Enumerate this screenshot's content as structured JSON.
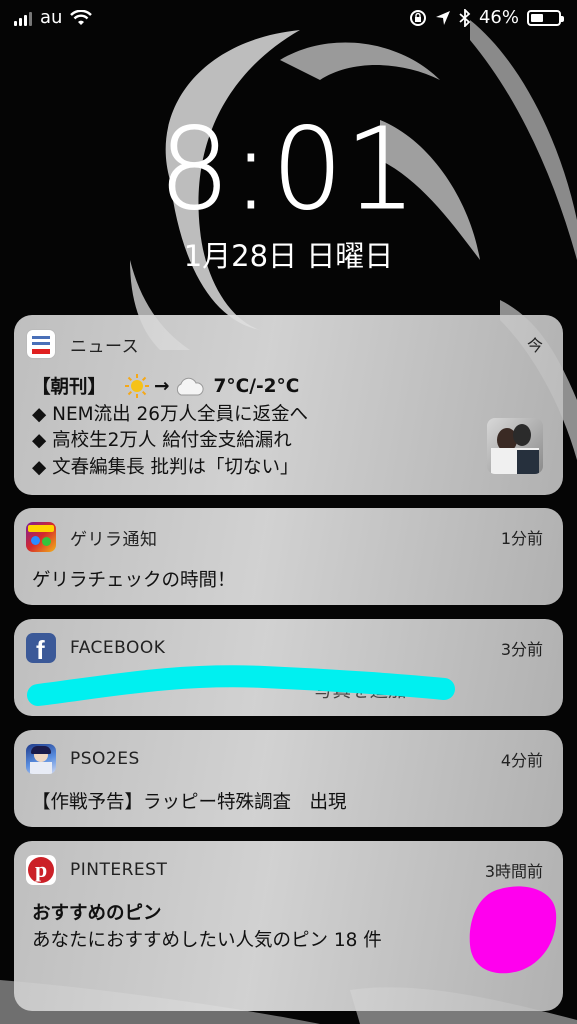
{
  "status_bar": {
    "carrier": "au",
    "battery_percent_text": "46%",
    "battery_level": 0.46
  },
  "lock_screen": {
    "time": "8:01",
    "date": "1月28日 日曜日"
  },
  "notifications": [
    {
      "app": "ニュース",
      "time": "今",
      "lines": {
        "line1_prefix": "【朝刊】",
        "line1_temp": "7°C/-2°C",
        "line2": "◆ NEM流出 26万人全員に返金へ",
        "line3": "◆ 高校生2万人 給付金支給漏れ",
        "line4": "◆ 文春編集長 批判は「切ない」"
      },
      "icons": {
        "sun": "sun-icon",
        "arrow": "→",
        "cloud": "cloud-icon"
      }
    },
    {
      "app": "ゲリラ通知",
      "time": "1分前",
      "body": "ゲリラチェックの時間！"
    },
    {
      "app": "FACEBOOK",
      "time": "3分前",
      "body_partial": "写真を追加"
    },
    {
      "app": "PSO2ES",
      "time": "4分前",
      "body": "【作戦予告】ラッピー特殊調査　出現"
    },
    {
      "app": "PINTEREST",
      "time": "3時間前",
      "title": "おすすめのピン",
      "body": "あなたにおすすめしたい人気のピン 18 件"
    }
  ],
  "colors": {
    "redaction_cyan": "#00f0f0",
    "redaction_magenta": "#ff00ee",
    "facebook_blue": "#3b5998",
    "pinterest_red": "#cb2027"
  }
}
